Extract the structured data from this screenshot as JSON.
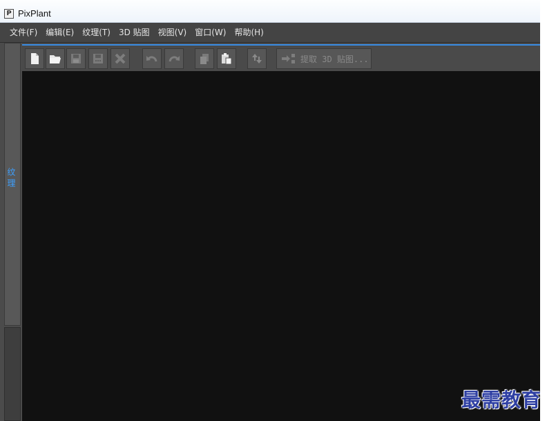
{
  "window": {
    "title": "PixPlant",
    "app_icon": "pixplant-logo-icon",
    "app_icon_glyph": "P"
  },
  "menu": {
    "items": [
      {
        "label": "文件(F)"
      },
      {
        "label": "编辑(E)"
      },
      {
        "label": "纹理(T)"
      },
      {
        "label": "3D 贴图"
      },
      {
        "label": "视图(V)"
      },
      {
        "label": "窗口(W)"
      },
      {
        "label": "帮助(H)"
      }
    ]
  },
  "toolbar": {
    "buttons": [
      {
        "icon": "new-file-icon",
        "enabled": true
      },
      {
        "icon": "open-folder-icon",
        "enabled": true
      },
      {
        "icon": "save-icon",
        "enabled": false
      },
      {
        "icon": "save-as-icon",
        "enabled": false
      },
      {
        "icon": "close-x-icon",
        "enabled": false
      },
      {
        "icon": "undo-icon",
        "enabled": false
      },
      {
        "icon": "redo-icon",
        "enabled": false
      },
      {
        "icon": "copy-icon",
        "enabled": false
      },
      {
        "icon": "paste-icon",
        "enabled": true
      },
      {
        "icon": "swap-icon",
        "enabled": false
      }
    ],
    "extract_label": "提取 3D 贴图..."
  },
  "left_dock": {
    "tab_label": "纹理"
  },
  "watermark": "最需教育",
  "colors": {
    "accent": "#3a8ee6",
    "tab_text": "#3da0ff",
    "canvas": "#111111",
    "menu_bg": "#444444"
  }
}
